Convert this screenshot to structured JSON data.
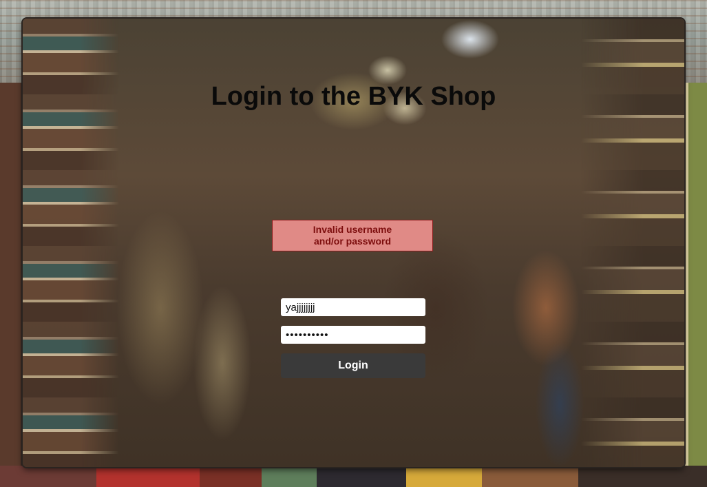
{
  "page": {
    "title": "Login to the BYK Shop"
  },
  "error": {
    "message": "Invalid username and/or password"
  },
  "form": {
    "username_value": "yajjjjjjjj",
    "password_value": "••••••••••",
    "login_label": "Login"
  },
  "colors": {
    "error_bg": "#e08a86",
    "error_border": "#8b1c1c",
    "error_text": "#7d0e0e",
    "button_bg": "#3a3a3a",
    "title_text": "#0a0a0a"
  }
}
